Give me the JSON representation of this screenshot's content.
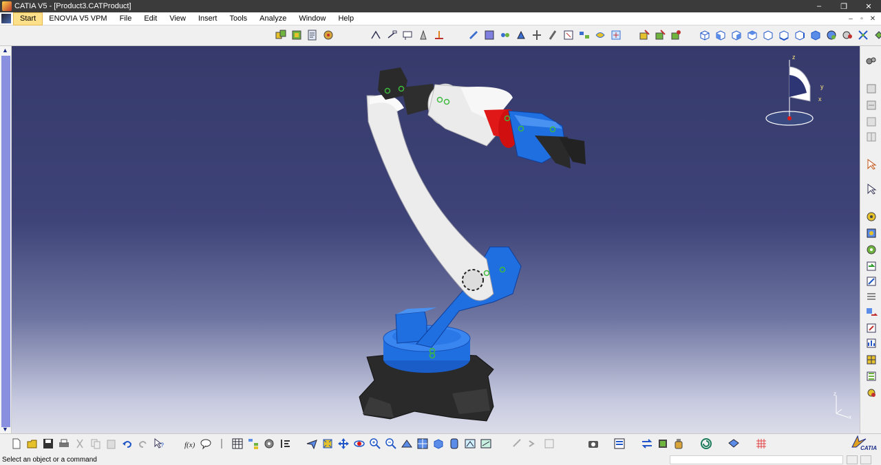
{
  "window": {
    "title": "CATIA V5 - [Product3.CATProduct]",
    "controls": [
      "–",
      "❐",
      "✕"
    ]
  },
  "menubar": {
    "items": [
      {
        "label": "Start"
      },
      {
        "label": "ENOVIA V5 VPM"
      },
      {
        "label": "File"
      },
      {
        "label": "Edit"
      },
      {
        "label": "View"
      },
      {
        "label": "Insert"
      },
      {
        "label": "Tools"
      },
      {
        "label": "Analyze"
      },
      {
        "label": "Window"
      },
      {
        "label": "Help"
      }
    ],
    "mdi_controls": [
      "–",
      "▫",
      "✕"
    ]
  },
  "compass": {
    "axis_x": "x",
    "axis_y": "y",
    "axis_z": "z"
  },
  "mini_axis": {
    "axis_x": "x",
    "axis_z": "z"
  },
  "statusbar": {
    "message": "Select an object or a command",
    "command_input": ""
  },
  "logo": {
    "text": "CATIA"
  },
  "colors": {
    "robot_blue": "#1f6fe0",
    "robot_white": "#ececec",
    "robot_black": "#2a2a2a",
    "gripper_red": "#e01818",
    "background_top": "#363a6b",
    "background_bottom": "#dcdde9",
    "scroll_thumb": "#8a90e0"
  },
  "icons": {
    "top_toolbar": [
      "assembly-icon",
      "component-icon",
      "product-icon",
      "part-icon",
      "update-icon",
      "snap-icon",
      "text-icon",
      "annotation-icon",
      "paint-icon",
      "design-icon",
      "catalog-icon",
      "manipulate-icon",
      "explode-icon",
      "stop-icon",
      "clash-icon",
      "constraint-icon",
      "fix-icon",
      "contact-icon",
      "offset-icon",
      "angle-icon",
      "fix-together-icon",
      "quick-constraint-icon",
      "reuse-pattern-icon",
      "change-constraint-icon",
      "iso-view-icon",
      "front-view-icon",
      "back-view-icon",
      "left-view-icon",
      "right-view-icon",
      "top-view-icon",
      "bottom-view-icon",
      "named-view-icon",
      "render-style-icon",
      "select-icon",
      "view-modes-icon"
    ],
    "right_toolbar": [
      "settings-icon",
      "sketcher-icon",
      "view-icon",
      "part-design-icon",
      "assembly-icon",
      "select-arrow-icon",
      "cursor-icon",
      "gear-icon",
      "gear2-icon",
      "gear3-icon",
      "update-icon",
      "replace-icon",
      "reorder-icon",
      "move-icon",
      "link-icon",
      "graph-icon",
      "table-icon",
      "insert-icon",
      "replace2-icon",
      "analysis-icon"
    ],
    "bottom_toolbar": [
      "new-icon",
      "open-icon",
      "save-icon",
      "print-icon",
      "cut-icon",
      "copy-icon",
      "paste-icon",
      "undo-icon",
      "redo-icon",
      "whats-this-icon",
      "formula-icon",
      "comment-icon",
      "knowledge-icon",
      "table-icon",
      "graph-icon",
      "measure-icon",
      "align-icon",
      "fly-icon",
      "fit-all-icon",
      "pan-icon",
      "rotate-icon",
      "zoom-in-icon",
      "zoom-out-icon",
      "normal-view-icon",
      "multi-view-icon",
      "iso-view-icon",
      "shading-icon",
      "hide-show-icon",
      "swap-visible-icon",
      "link1-icon",
      "link2-icon",
      "link3-icon",
      "camera-icon",
      "compare-icon",
      "exchange-icon",
      "tools-icon",
      "bottle-icon",
      "refresh-icon",
      "cube-icon",
      "grid-icon"
    ]
  }
}
